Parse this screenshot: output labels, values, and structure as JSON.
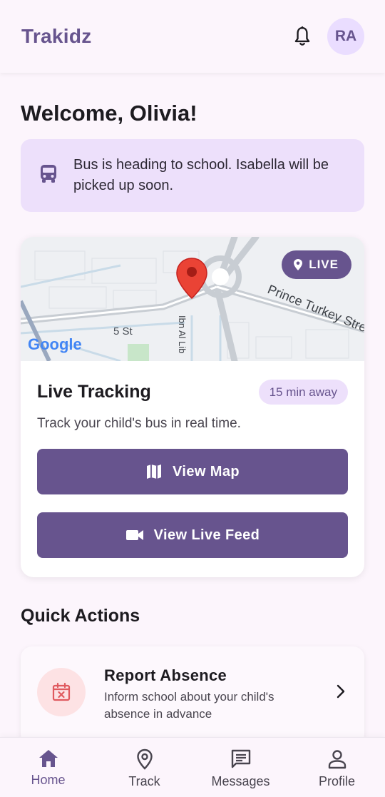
{
  "header": {
    "title": "Trakidz",
    "avatar_initials": "RA"
  },
  "welcome": "Welcome, Olivia!",
  "status_banner": {
    "text": "Bus is heading to school. Isabella will be picked up soon.",
    "icon": "bus-icon"
  },
  "tracking_card": {
    "live_badge": "LIVE",
    "map_labels": [
      "Prince Turkey Stre",
      "5 St",
      "Ibn Al Lib",
      "Google"
    ],
    "title": "Live Tracking",
    "eta": "15 min away",
    "description": "Track your child's bus in real time.",
    "view_map_label": "View Map",
    "view_feed_label": "View Live Feed"
  },
  "quick_actions": {
    "title": "Quick Actions",
    "items": [
      {
        "title": "Report Absence",
        "description": "Inform school about your child's absence in advance",
        "icon": "calendar-x-icon"
      }
    ]
  },
  "bottom_nav": [
    {
      "label": "Home",
      "icon": "home-icon",
      "active": true
    },
    {
      "label": "Track",
      "icon": "location-pin-icon",
      "active": false
    },
    {
      "label": "Messages",
      "icon": "message-icon",
      "active": false
    },
    {
      "label": "Profile",
      "icon": "person-icon",
      "active": false
    }
  ],
  "colors": {
    "primary": "#67548e",
    "banner": "#ede0fb",
    "background": "#fcf5fc",
    "alert_icon": "#e05a5f"
  }
}
